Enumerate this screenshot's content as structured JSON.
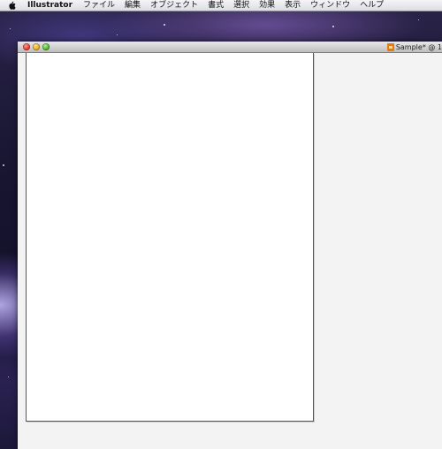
{
  "menubar": {
    "apple_icon": "apple-icon",
    "app_name": "Illustrator",
    "items": [
      "ファイル",
      "編集",
      "オブジェクト",
      "書式",
      "選択",
      "効果",
      "表示",
      "ウィンドウ",
      "ヘルプ"
    ]
  },
  "window": {
    "title": "Sample* @ 1",
    "title_icon": "illustrator-document-icon",
    "buttons": {
      "close": "close-button",
      "minimize": "minimize-button",
      "zoom": "zoom-button"
    }
  },
  "colors": {
    "close": "#d9271c",
    "minimize": "#d99a12",
    "zoom": "#3a9f1d",
    "canvas_background": "#f3f3f3",
    "artboard": "#ffffff"
  }
}
